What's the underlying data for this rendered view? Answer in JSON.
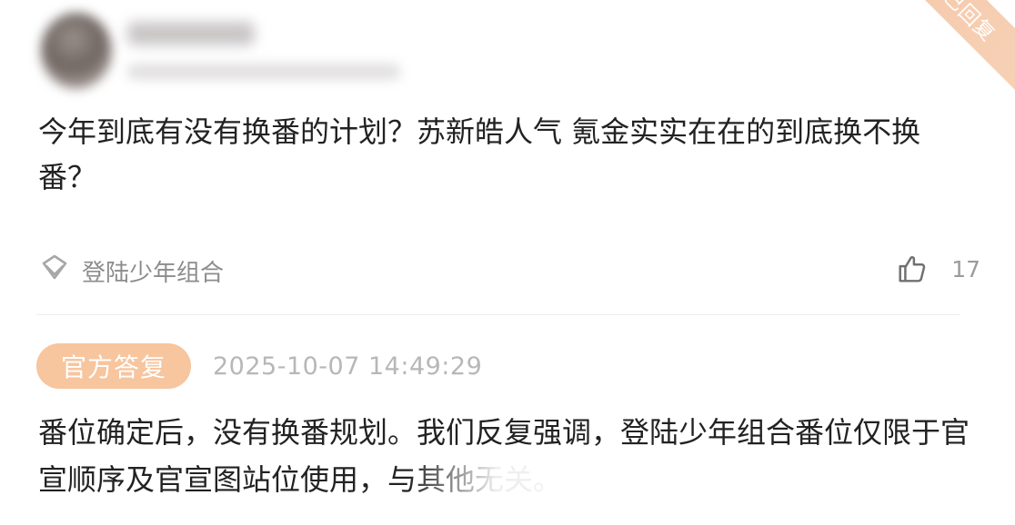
{
  "author": {
    "name_blurred": true
  },
  "status_ribbon": {
    "label": "已回复"
  },
  "question": {
    "text": "今年到底有没有换番的计划？苏新皓人气 氪金实实在在的到底换不换番？"
  },
  "topic": {
    "label": "登陆少年组合",
    "icon": "diamond-icon"
  },
  "likes": {
    "icon": "thumbs-up-icon",
    "count": "17"
  },
  "answer": {
    "badge": "官方答复",
    "timestamp": "2025-10-07 14:49:29",
    "text": "番位确定后，没有换番规划。我们反复强调，登陆少年组合番位仅限于官宣顺序及官宣图站位使用，与其他无关。"
  },
  "colors": {
    "badge_bg": "#f7c59e",
    "ribbon_bg": "#f4c7a7",
    "muted_text": "#8c8c8c"
  }
}
